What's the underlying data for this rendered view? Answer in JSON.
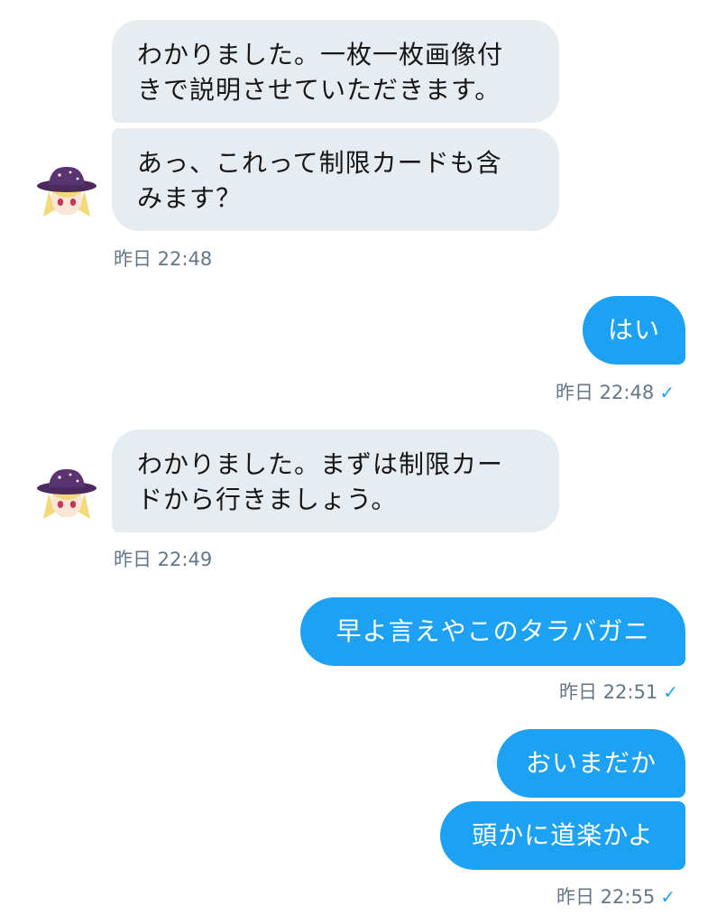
{
  "conversation": {
    "group1": {
      "messages": [
        "わかりました。一枚一枚画像付\nきで説明させていただきます。",
        "あっ、これって制限カードも含\nみます？"
      ],
      "timestamp": "昨日 22:48"
    },
    "group2": {
      "messages": [
        "はい"
      ],
      "timestamp": "昨日 22:48"
    },
    "group3": {
      "messages": [
        "わかりました。まずは制限カー\nドから行きましょう。"
      ],
      "timestamp": "昨日 22:49"
    },
    "group4": {
      "messages": [
        "早よ言えやこのタラバガニ"
      ],
      "timestamp": "昨日 22:51"
    },
    "group5": {
      "messages": [
        "おいまだか",
        "頭かに道楽かよ"
      ],
      "timestamp": "昨日 22:55"
    }
  },
  "icons": {
    "read_receipt": "checkmark-icon",
    "avatar": "anime-girl-witch-hat-avatar"
  },
  "colors": {
    "incoming_bubble": "#e6ecf0",
    "outgoing_bubble": "#1da1f2",
    "timestamp_text": "#657786",
    "check": "#1da1f2"
  },
  "read_check_glyph": "✓"
}
